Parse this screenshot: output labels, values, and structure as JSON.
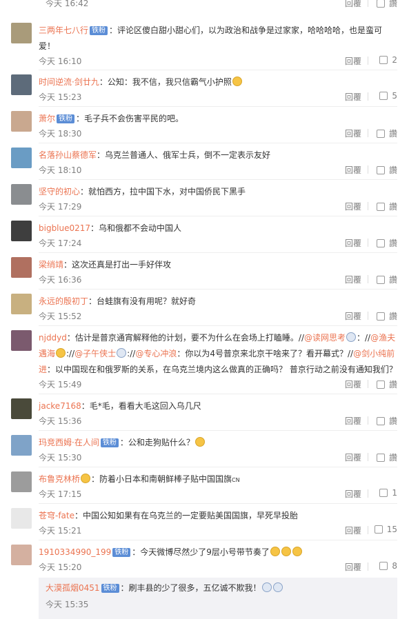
{
  "top": {
    "time": "今天 16:42",
    "reply": "回覆",
    "like": "讚"
  },
  "comments": [
    {
      "name": "三两年七八行",
      "badge": "铁粉",
      "text": "：评论区傻白甜小甜心们，以为政治和战争是过家家，哈哈哈哈，也是蛮可爱！",
      "time": "今天 16:10",
      "reply": "回覆",
      "like": "2"
    },
    {
      "name": "时间逆流·剑廿九",
      "badge": "",
      "text": "：公知：我不信，我只信霸气小护照",
      "time": "今天 15:23",
      "reply": "回覆",
      "like": "5"
    },
    {
      "name": "萧尔",
      "badge": "铁粉",
      "text": "：毛子兵不会伤害平民的吧。",
      "time": "今天 18:30",
      "reply": "回覆",
      "like": "讚"
    },
    {
      "name": "名落孙山蔡德军",
      "badge": "",
      "text": "：乌克兰普通人、俄军士兵，倒不一定表示友好",
      "time": "今天 18:10",
      "reply": "回覆",
      "like": "讚"
    },
    {
      "name": "坚守的初心",
      "badge": "",
      "text": "：就怕西方，拉中国下水，对中国侨民下黑手",
      "time": "今天 17:29",
      "reply": "回覆",
      "like": "讚"
    },
    {
      "name": "bigblue0217",
      "badge": "",
      "text": "：乌和俄都不会动中国人",
      "time": "今天 17:24",
      "reply": "回覆",
      "like": "讚"
    },
    {
      "name": "梁绡靖",
      "badge": "",
      "text": "：这次还真是打出一手好伴攻",
      "time": "今天 16:36",
      "reply": "回覆",
      "like": "讚"
    },
    {
      "name": "永远的殷初丁",
      "badge": "",
      "text": "：台蛙旗有没有用呢？就好奇",
      "time": "今天 15:52",
      "reply": "回覆",
      "like": "讚"
    },
    {
      "name": "njddyd",
      "badge": "",
      "text": "：估计是普京通宵解释他的计划，要不为什么在会场上打瞌睡。//",
      "mention1": "@读网思考",
      "mid1": "：//",
      "mention2": "@渔夫遇海",
      "mid2": "://",
      "mention3": "@子午侠士",
      "mid3": "://",
      "mention4": "@专心冲浪",
      "mid4": "：你以为4号普京来北京干啥来了？看开幕式？//",
      "mention5": "@剑小纯前进",
      "text2": "：以中国现在和俄罗斯的关系，在乌克兰境内这么做真的正确吗？ 普京行动之前没有通知我们？",
      "time": "今天 15:49",
      "reply": "回覆",
      "like": "讚"
    },
    {
      "name": "jacke7168",
      "badge": "",
      "text": "：毛*毛，看看大毛这回入乌几尺",
      "time": "今天 15:36",
      "reply": "回覆",
      "like": "讚"
    },
    {
      "name": "玛竞西姆·在人间",
      "badge": "铁粉",
      "text": "：公和走狗贴什么？",
      "time": "今天 15:30",
      "reply": "回覆",
      "like": "讚"
    },
    {
      "name": "布鲁克林桥",
      "badge": "",
      "text": "：防着小日本和南朝鲜棒子贴中国国旗",
      "cn": "CN",
      "time": "今天 17:15",
      "reply": "回覆",
      "like": "1"
    },
    {
      "name": "苍穹-fate",
      "badge": "",
      "text": "：中国公知如果有在乌克兰的一定要贴美国国旗，早死早投胎",
      "time": "今天 15:21",
      "reply": "回覆",
      "like": "15"
    },
    {
      "name": "1910334990_199",
      "badge": "铁粉",
      "text": "：今天微博尽然少了9层小号带节奏了",
      "time": "今天 15:20",
      "reply": "回覆",
      "like": "8"
    }
  ],
  "subreply": {
    "name": "大漠孤烟0451",
    "badge": "铁粉",
    "text": "：刷丰县的少了很多，五亿诚不欺我！",
    "time": "今天 15:35"
  },
  "colors": {
    "accent": "#eb7350",
    "badge": "#5b8dd6",
    "meta": "#808080"
  }
}
